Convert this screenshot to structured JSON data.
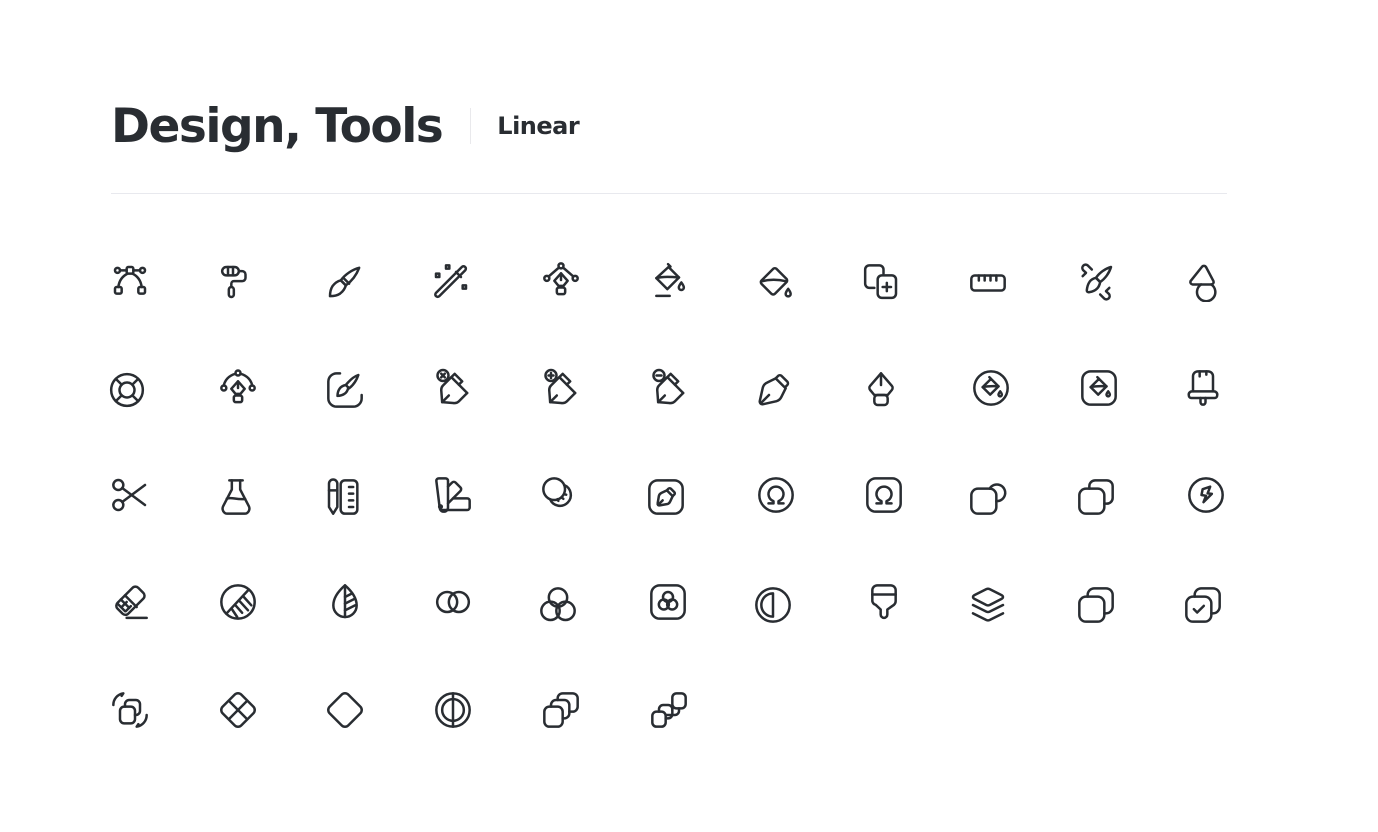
{
  "header": {
    "title": "Design, Tools",
    "variant": "Linear"
  },
  "colors": {
    "icon_stroke": "#292d32",
    "title": "#292d32",
    "divider": "#e8e9ee",
    "background": "#ffffff"
  },
  "icons": [
    [
      "bezier-path-icon",
      "paint-roller-icon",
      "paint-brush-icon",
      "magic-wand-icon",
      "pen-tool-nodes-icon",
      "paint-bucket-fill-icon",
      "paint-bucket-icon",
      "copy-add-icon",
      "ruler-icon",
      "brush-brush-icon",
      "shapes-icon"
    ],
    [
      "lifebuoy-icon",
      "pen-tool-curve-icon",
      "brush-square-icon",
      "pen-close-icon",
      "pen-add-icon",
      "pen-remove-icon",
      "pen-icon",
      "pen-nib-icon",
      "paint-bucket-circle-icon",
      "paint-bucket-square-icon",
      "broom-brush-icon"
    ],
    [
      "scissors-icon",
      "flask-icon",
      "pencil-ruler-icon",
      "color-swatch-icon",
      "blur-icon",
      "pen-square-icon",
      "omega-circle-icon",
      "omega-square-icon",
      "shape-circle-square-icon",
      "shape-squares-icon",
      "flash-circle-icon"
    ],
    [
      "eraser-icon",
      "glass-circle-icon",
      "leaf-icon",
      "circles-overlap-icon",
      "color-circles-icon",
      "color-circles-square-icon",
      "contrast-icon",
      "brush-big-icon",
      "layers-icon",
      "copy-icon",
      "copy-success-icon"
    ],
    [
      "convert-shape-icon",
      "diamond-grid-icon",
      "diamond-icon",
      "mirror-circle-icon",
      "squares-stack-icon",
      "squares-chain-icon"
    ]
  ]
}
